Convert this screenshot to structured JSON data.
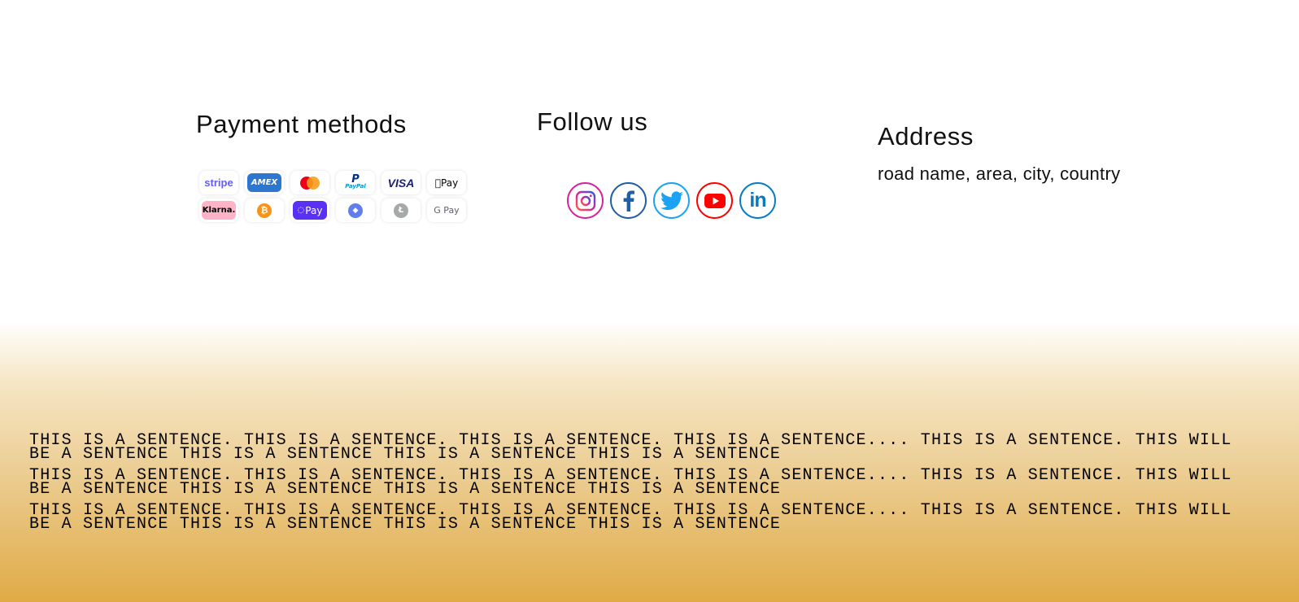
{
  "payment": {
    "title": "Payment methods",
    "methods": [
      {
        "label": "stripe",
        "icon": "stripe-icon",
        "color": "#635bff",
        "bg": "#ffffff"
      },
      {
        "label": "AMEX",
        "icon": "amex-icon",
        "color": "#ffffff",
        "bg": "#2e77d0"
      },
      {
        "label": "",
        "icon": "mastercard-icon",
        "color": "#eb001b",
        "bg": "#ffffff"
      },
      {
        "label": "PayPal",
        "icon": "paypal-icon",
        "color": "#003087",
        "bg": "#ffffff"
      },
      {
        "label": "VISA",
        "icon": "visa-icon",
        "color": "#1a1f71",
        "bg": "#ffffff"
      },
      {
        "label": "Pay",
        "icon": "apple-pay-icon",
        "color": "#000000",
        "bg": "#ffffff"
      },
      {
        "label": "Klarna.",
        "icon": "klarna-icon",
        "color": "#000000",
        "bg": "#ffb3c7"
      },
      {
        "label": "₿",
        "icon": "bitcoin-icon",
        "color": "#f7931a",
        "bg": "#ffffff"
      },
      {
        "label": "Pay",
        "icon": "opay-icon",
        "color": "#ffffff",
        "bg": "#5a31f4"
      },
      {
        "label": "◆",
        "icon": "ethereum-icon",
        "color": "#627eea",
        "bg": "#ffffff"
      },
      {
        "label": "Ł",
        "icon": "litecoin-icon",
        "color": "#a6a9aa",
        "bg": "#ffffff"
      },
      {
        "label": "G Pay",
        "icon": "google-pay-icon",
        "color": "#5f6368",
        "bg": "#ffffff"
      }
    ]
  },
  "follow": {
    "title": "Follow us",
    "icons": [
      {
        "name": "instagram-icon",
        "color": "#d6249f"
      },
      {
        "name": "facebook-icon",
        "color": "#1e5fa8"
      },
      {
        "name": "twitter-icon",
        "color": "#1da1f2"
      },
      {
        "name": "youtube-icon",
        "color": "#ff0000"
      },
      {
        "name": "linkedin-icon",
        "color": "#0a7bc2"
      }
    ]
  },
  "address": {
    "title": "Address",
    "text": "road name, area, city, country"
  },
  "footer": {
    "paragraphs": [
      "This is a sentence. This is a sentence. This is a sentence. This is a sentence.... This is a sentence. This will be a sentence This is a sentence This is a sentence This is a sentence",
      "This is a sentence. This is a sentence. This is a sentence. This is a sentence.... This is a sentence. This will be a sentence This is a sentence This is a sentence This is a sentence",
      "This is a sentence. This is a sentence. This is a sentence. This is a sentence.... This is a sentence. This will be a sentence This is a sentence This is a sentence This is a sentence"
    ]
  },
  "colors": {
    "gradient_top": "#ffffff",
    "gradient_bottom": "#e0ab45",
    "text": "#111111"
  }
}
